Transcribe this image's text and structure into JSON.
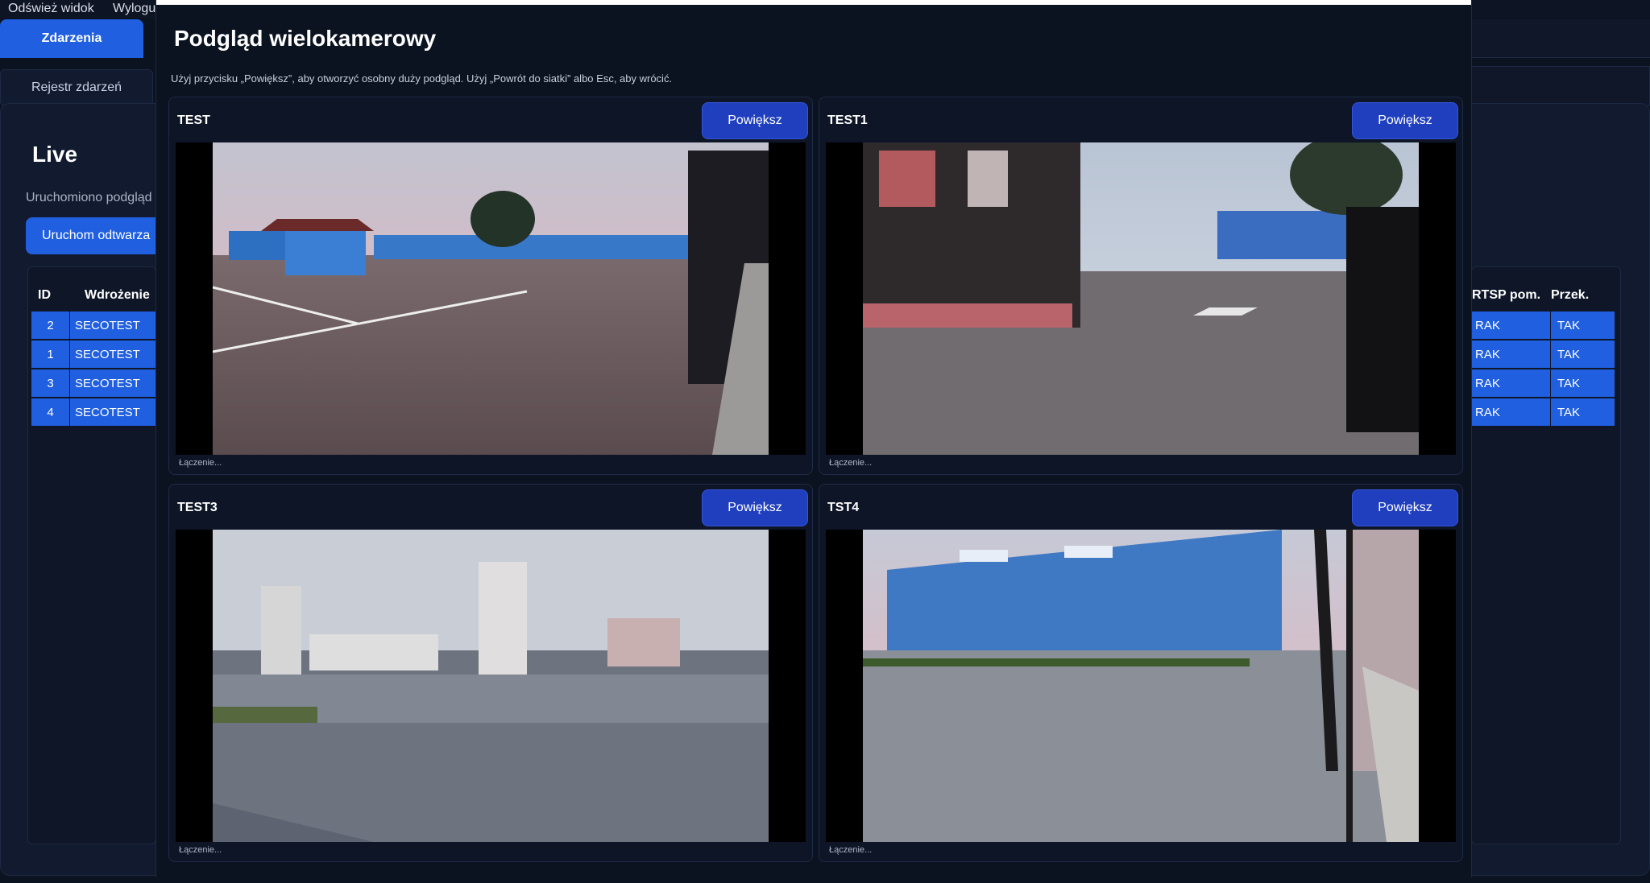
{
  "top_menu": [
    "Odśwież widok",
    "Wylogu"
  ],
  "nav": {
    "active_tab": "Zdarzenia",
    "subtab": "Rejestr zdarzeń"
  },
  "live": {
    "title": "Live",
    "status": "Uruchomiono podgląd",
    "play_button": "Uruchom odtwarza"
  },
  "bg_table": {
    "headers_left": [
      "ID",
      "Wdrożenie"
    ],
    "headers_right": [
      "RTSP pom.",
      "Przek."
    ],
    "rows": [
      {
        "id": "2",
        "wdrozenie": "SECOTEST",
        "rtsp": "RAK",
        "przek": "TAK"
      },
      {
        "id": "1",
        "wdrozenie": "SECOTEST",
        "rtsp": "RAK",
        "przek": "TAK"
      },
      {
        "id": "3",
        "wdrozenie": "SECOTEST",
        "rtsp": "RAK",
        "przek": "TAK"
      },
      {
        "id": "4",
        "wdrozenie": "SECOTEST",
        "rtsp": "RAK",
        "przek": "TAK"
      }
    ]
  },
  "modal": {
    "title": "Podgląd wielokamerowy",
    "hint": "Użyj przycisku „Powiększ”, aby otworzyć osobny duży podgląd. Użyj „Powrót do siatki” albo Esc, aby wrócić.",
    "cameras": [
      {
        "name": "TEST",
        "button": "Powiększ",
        "status": "Łączenie..."
      },
      {
        "name": "TEST1",
        "button": "Powiększ",
        "status": "Łączenie..."
      },
      {
        "name": "TEST3",
        "button": "Powiększ",
        "status": "Łączenie..."
      },
      {
        "name": "TST4",
        "button": "Powiększ",
        "status": "Łączenie..."
      }
    ]
  },
  "colors": {
    "accent": "#1f5fe0",
    "button": "#1f3fbf",
    "background": "#0b1220"
  }
}
